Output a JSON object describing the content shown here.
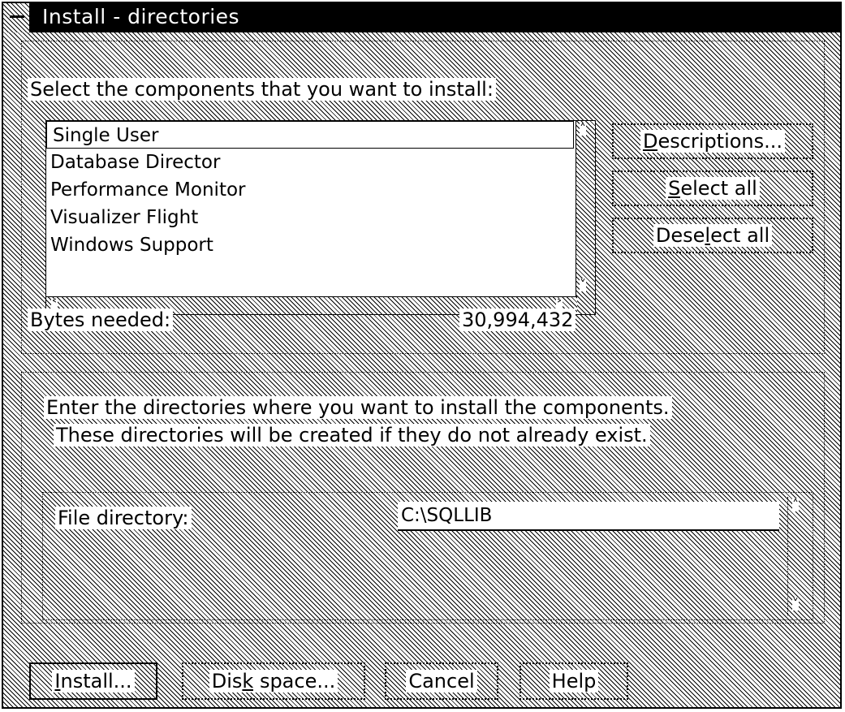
{
  "window": {
    "title": "Install - directories"
  },
  "components": {
    "prompt": "Select the components that you want to install:",
    "items": [
      {
        "label": "Single User",
        "selected": true
      },
      {
        "label": "Database Director",
        "selected": false
      },
      {
        "label": "Performance Monitor",
        "selected": false
      },
      {
        "label": "Visualizer Flight",
        "selected": false
      },
      {
        "label": "Windows Support",
        "selected": false
      }
    ],
    "bytes_label": "Bytes needed:",
    "bytes_value": "30,994,432"
  },
  "side_buttons": {
    "descriptions": {
      "mn": "D",
      "rest": "escriptions..."
    },
    "select_all": {
      "mn": "S",
      "rest": "elect all"
    },
    "deselect_all": {
      "pre": "Dese",
      "mn": "l",
      "rest": "ect all"
    }
  },
  "directories": {
    "instruction_line1": "Enter the directories where you want to install the components.",
    "instruction_line2": "These directories will be created if they do not already exist.",
    "file_dir_label": "File directory:",
    "file_dir_value": "C:\\SQLLIB"
  },
  "bottom_buttons": {
    "install": {
      "mn": "I",
      "rest": "nstall..."
    },
    "disk_space": {
      "pre": "Dis",
      "mn": "k",
      "rest": " space..."
    },
    "cancel": "Cancel",
    "help": "Help"
  }
}
